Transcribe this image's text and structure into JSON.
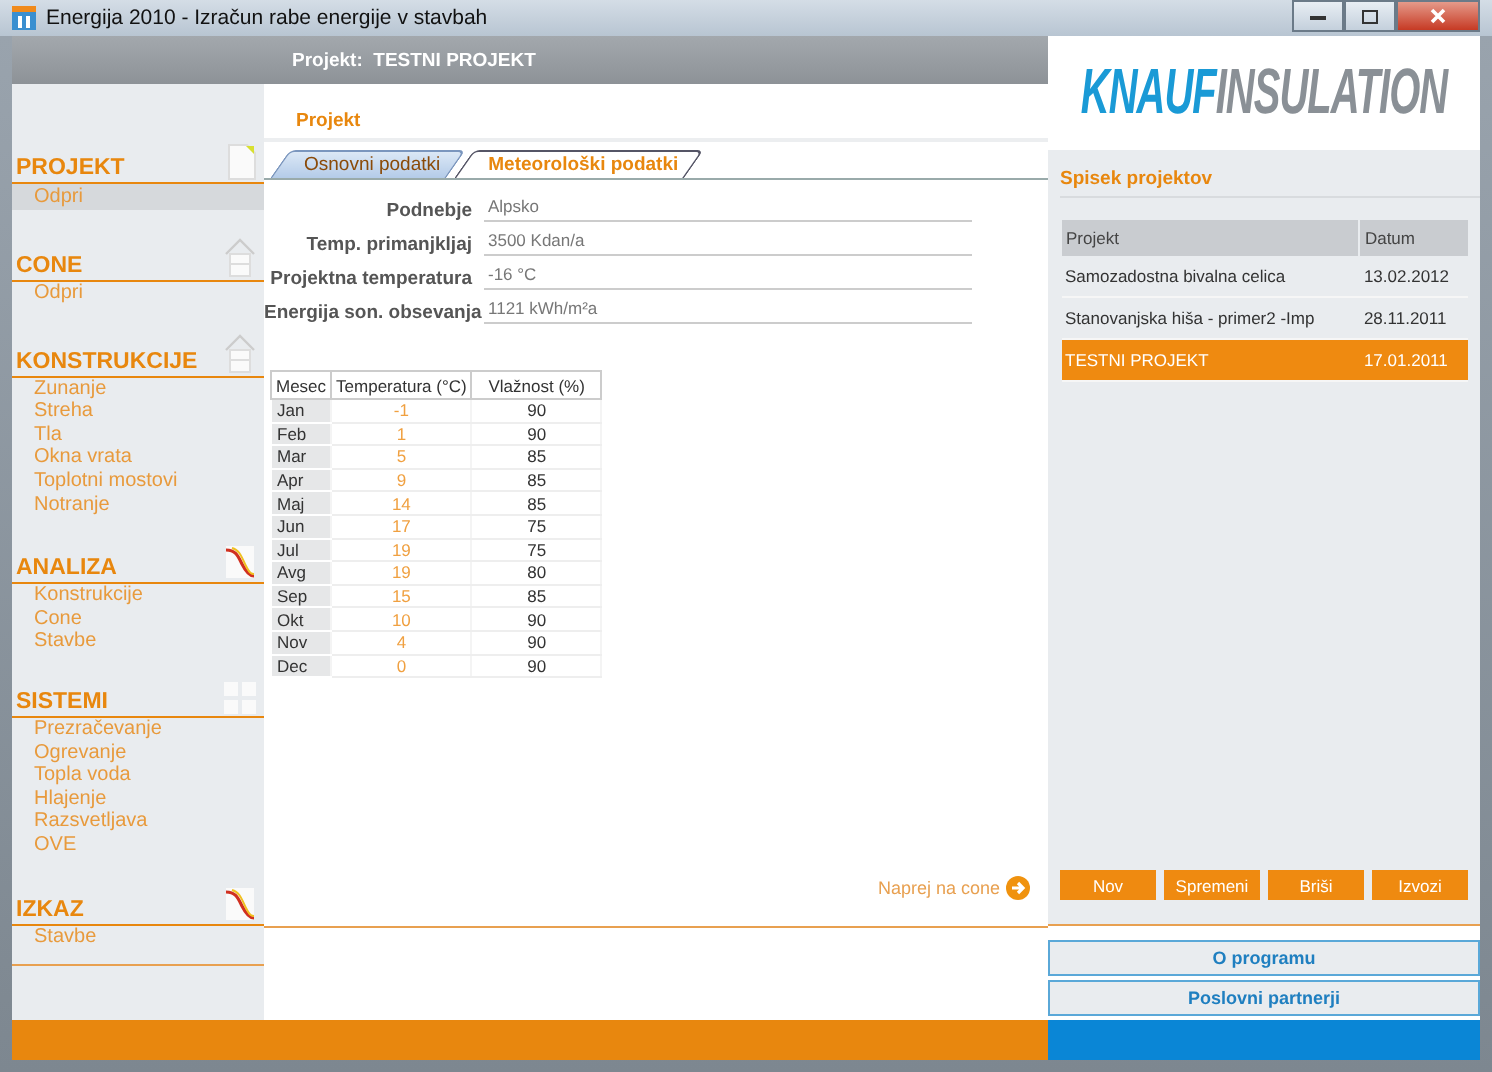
{
  "window": {
    "title": "Energija 2010 - Izračun rabe energije v stavbah"
  },
  "header": {
    "label": "Projekt:",
    "project": "TESTNI PROJEKT"
  },
  "sidebar": {
    "sections": [
      {
        "title": "PROJEKT",
        "items": [
          {
            "label": "Odpri",
            "selected": true
          }
        ]
      },
      {
        "title": "CONE",
        "items": [
          {
            "label": "Odpri",
            "selected": false
          }
        ]
      },
      {
        "title": "KONSTRUKCIJE",
        "items": [
          {
            "label": "Zunanje",
            "selected": false
          },
          {
            "label": "Streha",
            "selected": false
          },
          {
            "label": "Tla",
            "selected": false
          },
          {
            "label": "Okna vrata",
            "selected": false
          },
          {
            "label": "Toplotni mostovi",
            "selected": false
          },
          {
            "label": "Notranje",
            "selected": false
          }
        ]
      },
      {
        "title": "ANALIZA",
        "items": [
          {
            "label": "Konstrukcije",
            "selected": false
          },
          {
            "label": "Cone",
            "selected": false
          },
          {
            "label": "Stavbe",
            "selected": false
          }
        ]
      },
      {
        "title": "SISTEMI",
        "items": [
          {
            "label": "Prezračevanje",
            "selected": false
          },
          {
            "label": "Ogrevanje",
            "selected": false
          },
          {
            "label": "Topla voda",
            "selected": false
          },
          {
            "label": "Hlajenje",
            "selected": false
          },
          {
            "label": "Razsvetljava",
            "selected": false
          },
          {
            "label": "OVE",
            "selected": false
          }
        ]
      },
      {
        "title": "IZKAZ",
        "items": [
          {
            "label": "Stavbe",
            "selected": false
          }
        ]
      }
    ]
  },
  "main": {
    "section_title": "Projekt",
    "tabs": [
      {
        "label": "Osnovni podatki",
        "selected": false
      },
      {
        "label": "Meteorološki podatki",
        "selected": true
      }
    ],
    "fields": [
      {
        "label": "Podnebje",
        "value": "Alpsko"
      },
      {
        "label": "Temp. primanjkljaj",
        "value": "3500 Kdan/a"
      },
      {
        "label": "Projektna temperatura",
        "value": "-16 °C"
      },
      {
        "label": "Energija son. obsevanja",
        "value": "1121 kWh/m²a"
      }
    ],
    "climate_table": {
      "columns": [
        "Mesec",
        "Temperatura (°C)",
        "Vlažnost (%)"
      ],
      "rows": [
        [
          "Jan",
          "-1",
          "90"
        ],
        [
          "Feb",
          "1",
          "90"
        ],
        [
          "Mar",
          "5",
          "85"
        ],
        [
          "Apr",
          "9",
          "85"
        ],
        [
          "Maj",
          "14",
          "85"
        ],
        [
          "Jun",
          "17",
          "75"
        ],
        [
          "Jul",
          "19",
          "75"
        ],
        [
          "Avg",
          "19",
          "80"
        ],
        [
          "Sep",
          "15",
          "85"
        ],
        [
          "Okt",
          "10",
          "90"
        ],
        [
          "Nov",
          "4",
          "90"
        ],
        [
          "Dec",
          "0",
          "90"
        ]
      ]
    },
    "next_link": "Naprej na cone"
  },
  "logo": {
    "part_1": "KNAUF",
    "part_2": "INSULATION"
  },
  "projects": {
    "title": "Spisek projektov",
    "columns": [
      "Projekt",
      "Datum"
    ],
    "rows": [
      {
        "name": "Samozadostna bivalna celica",
        "date": "13.02.2012",
        "selected": false
      },
      {
        "name": "Stanovanjska hiša - primer2 -Imp",
        "date": "28.11.2011",
        "selected": false
      },
      {
        "name": "TESTNI PROJEKT",
        "date": "17.01.2011",
        "selected": true
      }
    ],
    "buttons": [
      "Nov",
      "Spremeni",
      "Briši",
      "Izvozi"
    ]
  },
  "links": [
    "O programu",
    "Poslovni partnerji"
  ]
}
